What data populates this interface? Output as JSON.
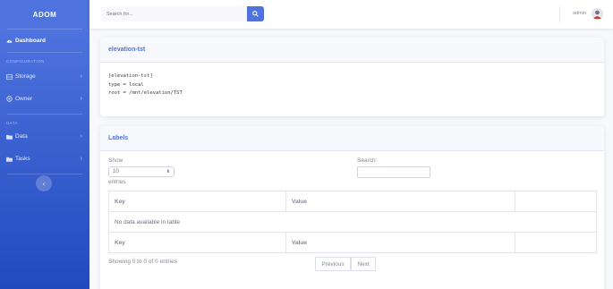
{
  "app": {
    "brand": "ADOM"
  },
  "sidebar": {
    "dashboard": "Dashboard",
    "configuration_heading": "CONFIGURATION",
    "storage": "Storage",
    "owner": "Owner",
    "data_heading": "DATA",
    "data": "Data",
    "tasks": "Tasks",
    "collapse_icon": "chevron-left-icon"
  },
  "topbar": {
    "search_placeholder": "Search for...",
    "user": "admin"
  },
  "storage_card": {
    "title": "elevation-tst",
    "config_lines": [
      "[elevation-tst]",
      "type = local",
      "root = /mnt/elevation/TST"
    ]
  },
  "labels_card": {
    "title": "Labels",
    "show_label": "Show",
    "page_length": "10",
    "entries_label": "entries",
    "search_label": "Search:",
    "columns": [
      "Key",
      "Value",
      ""
    ],
    "empty_message": "No data available in table",
    "info": "Showing 0 to 0 of 0 entries",
    "previous": "Previous",
    "next": "Next"
  },
  "colors": {
    "primary": "#4e73df",
    "sidebar_end": "#224abe"
  }
}
